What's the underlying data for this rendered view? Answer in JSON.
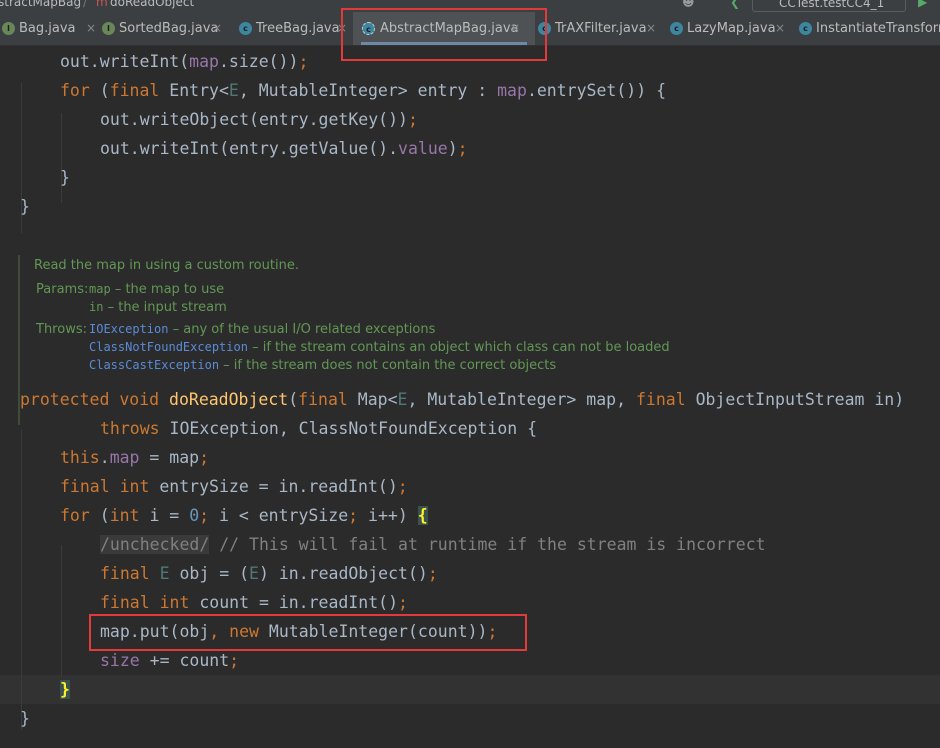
{
  "breadcrumb": {
    "items": [
      "stractMapBag",
      "doReadObject"
    ],
    "separator": "/"
  },
  "run_config": {
    "label": "CCTest.testCC4_1"
  },
  "tabs": [
    {
      "label": "Bag.java",
      "icon": "interface-icon",
      "color": "#6a8759"
    },
    {
      "label": "SortedBag.java",
      "icon": "interface-icon",
      "color": "#6a8759"
    },
    {
      "label": "TreeBag.java",
      "icon": "class-icon",
      "color": "#3e86a0"
    },
    {
      "label": "AbstractMapBag.java",
      "icon": "abstract-class-icon",
      "color": "#3e86a0",
      "active": true
    },
    {
      "label": "TrAXFilter.java",
      "icon": "class-icon",
      "color": "#3e86a0"
    },
    {
      "label": "LazyMap.java",
      "icon": "class-icon",
      "color": "#3e86a0"
    },
    {
      "label": "InstantiateTransformer.java",
      "icon": "class-icon",
      "color": "#3e86a0"
    }
  ],
  "code": {
    "l1": {
      "a": "out.writeInt(",
      "b": "map",
      "c": ".size())",
      "d": ";"
    },
    "l2": {
      "a": "for ",
      "b": "(",
      "c": "final ",
      "d": "Entry<",
      "e": "E",
      "f": ", MutableInteger> entry : ",
      "g": "map",
      "h": ".entrySet()) {"
    },
    "l3": {
      "a": "out.writeObject(entry.getKey())",
      "b": ";"
    },
    "l4": {
      "a": "out.writeInt(entry.getValue().",
      "b": "value",
      "c": ")",
      "d": ";"
    },
    "l5": "}",
    "l6": "}",
    "s1": {
      "a": "protected void ",
      "b": "doReadObject",
      "c": "(",
      "d": "final ",
      "e": "Map<",
      "f": "E",
      "g": ", MutableInteger> map, ",
      "h": "final ",
      "i": "ObjectInputStream in)"
    },
    "s2": {
      "a": "throws ",
      "b": "IOException, ClassNotFoundException {"
    },
    "s3": {
      "a": "this",
      "b": ".",
      "c": "map",
      "d": " = map",
      "e": ";"
    },
    "s4": {
      "a": "final int ",
      "b": "entrySize = in.readInt()",
      "c": ";"
    },
    "s5": {
      "a": "for ",
      "b": "(",
      "c": "int ",
      "d": "i = ",
      "e": "0",
      "f": "; ",
      "g": "i < entrySize",
      "h": "; ",
      "i": "i++) ",
      "j": "{"
    },
    "s6": {
      "a": "/unchecked/",
      "b": " // This will fail at runtime if the stream is incorrect"
    },
    "s7": {
      "a": "final ",
      "b": "E",
      "c": " obj = (",
      "d": "E",
      "e": ") in.readObject()",
      "f": ";"
    },
    "s8": {
      "a": "final int ",
      "b": "count = in.readInt()",
      "c": ";"
    },
    "s9": {
      "a": "map.put(obj",
      "b": ", ",
      "c": "new ",
      "d": "MutableInteger(count))",
      "e": ";"
    },
    "s10": {
      "a": "size",
      "b": " += count",
      "c": ";"
    },
    "s11": "}",
    "s12": "}"
  },
  "javadoc": {
    "summary": "Read the map in using a custom routine.",
    "params_label": "Params:",
    "params": [
      {
        "name": "map",
        "desc": " – the map to use"
      },
      {
        "name": "in",
        "desc": " – the input stream"
      }
    ],
    "throws_label": "Throws:",
    "throws": [
      {
        "name": "IOException",
        "desc": " – any of the usual I/O related exceptions"
      },
      {
        "name": "ClassNotFoundException",
        "desc": " – if the stream contains an object which class can not be loaded"
      },
      {
        "name": "ClassCastException",
        "desc": " – if the stream does not contain the correct objects"
      }
    ]
  },
  "annotations": {
    "highlight_color": "#e03a3a"
  }
}
